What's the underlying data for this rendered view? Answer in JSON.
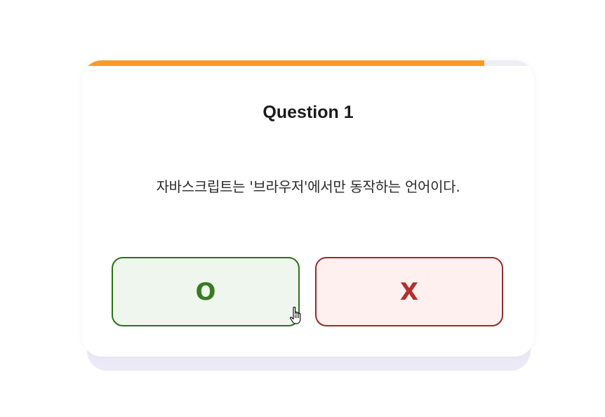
{
  "quiz": {
    "progress_fraction": 0.89,
    "progress_color": "#ff9a1f",
    "title": "Question 1",
    "question_text": "자바스크립트는 '브라우저'에서만 동작하는 언어이다.",
    "answers": [
      {
        "label": "O",
        "color": "#3a7a22"
      },
      {
        "label": "X",
        "color": "#b3302c"
      }
    ]
  },
  "pointer": {
    "icon": "hand-pointer-icon"
  }
}
